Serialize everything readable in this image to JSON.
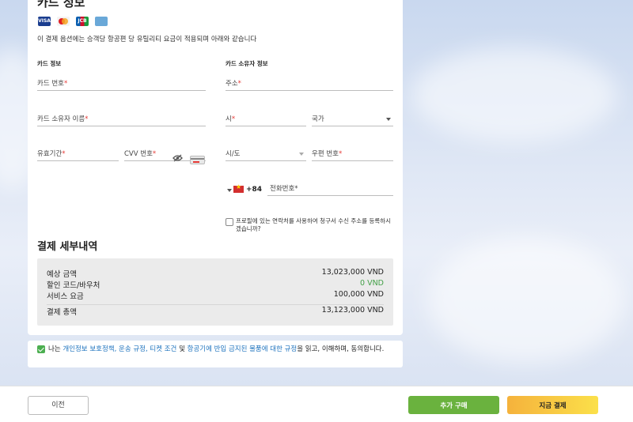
{
  "card_info": {
    "title": "카드 정보",
    "brands": [
      {
        "name": "visa-icon",
        "label": "VISA"
      },
      {
        "name": "mastercard-icon",
        "label": ""
      },
      {
        "name": "jcb-icon",
        "label": "JCB"
      },
      {
        "name": "amex-icon",
        "label": ""
      }
    ],
    "notice": "이 결제 옵션에는 승객당 항공편 당 유틸리티 요금이 적용되며 아래와 같습니다",
    "left_section": "카드 정보",
    "right_section": "카드 소유자 정보",
    "fields": {
      "card_number": "카드 번호",
      "card_holder": "카드 소유자 이름",
      "expiry": "유효기간",
      "cvv": "CVV 번호",
      "address": "주소",
      "city": "시",
      "country": "국가",
      "state": "시/도",
      "zip": "우편 번호",
      "phone": "전화번호"
    },
    "required_mark": "*",
    "dial_code": "+84",
    "profile_contact": "프로필에 있는 연락처를 사용하여 청구서 수신 주소를 등록하시겠습니까?"
  },
  "payment": {
    "title": "결제 세부내역",
    "rows": [
      {
        "label": "예상 금액",
        "value": "13,023,000 VND"
      },
      {
        "label": "할인 코드/바우처",
        "value": "0 VND"
      },
      {
        "label": "서비스 요금",
        "value": "100,000 VND"
      }
    ],
    "total_label": "결제 총액",
    "total_value": "13,123,000 VND"
  },
  "agreement": {
    "prefix": "나는 ",
    "link1": "개인정보 보호정책, 운송 규정, 티켓 조건",
    "mid": " 및 ",
    "link2": "항공기에 반입 금지된 물품에 대한 규정",
    "suffix": "을 읽고, 이해하며, 동의합니다."
  },
  "footer": {
    "prev": "이전",
    "add_purchase": "추가 구매",
    "pay_now": "지금 결제"
  },
  "colors": {
    "required": "#e53935",
    "discount": "#43a047",
    "link": "#1e73be",
    "add_btn": "#6ab23e",
    "pay_btn": "#f5b23c"
  }
}
